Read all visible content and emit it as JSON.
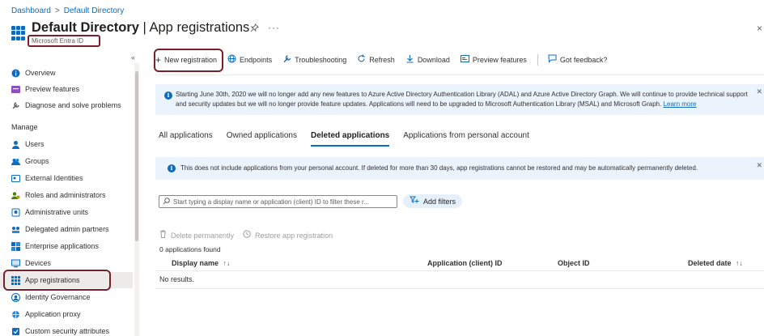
{
  "breadcrumb": {
    "items": [
      "Dashboard",
      "Default Directory"
    ]
  },
  "header": {
    "title_bold": "Default Directory",
    "title_rest": " | App registrations",
    "pin_icon": "pin-icon",
    "more": "···",
    "subtitle": "Microsoft Entra ID",
    "close": "×"
  },
  "sidebar": {
    "collapse": "«",
    "top_items": [
      {
        "label": "Overview",
        "icon": "info-icon"
      },
      {
        "label": "Preview features",
        "icon": "preview-icon"
      },
      {
        "label": "Diagnose and solve problems",
        "icon": "wrench-icon"
      }
    ],
    "section": "Manage",
    "manage_items": [
      {
        "label": "Users",
        "icon": "user-icon"
      },
      {
        "label": "Groups",
        "icon": "group-icon"
      },
      {
        "label": "External Identities",
        "icon": "external-identities-icon"
      },
      {
        "label": "Roles and administrators",
        "icon": "roles-icon"
      },
      {
        "label": "Administrative units",
        "icon": "admin-units-icon"
      },
      {
        "label": "Delegated admin partners",
        "icon": "partners-icon"
      },
      {
        "label": "Enterprise applications",
        "icon": "enterprise-apps-icon"
      },
      {
        "label": "Devices",
        "icon": "devices-icon"
      },
      {
        "label": "App registrations",
        "icon": "app-registrations-icon",
        "active": true
      },
      {
        "label": "Identity Governance",
        "icon": "governance-icon"
      },
      {
        "label": "Application proxy",
        "icon": "proxy-icon"
      },
      {
        "label": "Custom security attributes",
        "icon": "attributes-icon"
      }
    ]
  },
  "toolbar": {
    "new_registration": "New registration",
    "endpoints": "Endpoints",
    "troubleshooting": "Troubleshooting",
    "refresh": "Refresh",
    "download": "Download",
    "preview_features": "Preview features",
    "feedback": "Got feedback?"
  },
  "banner1": {
    "text": "Starting June 30th, 2020 we will no longer add any new features to Azure Active Directory Authentication Library (ADAL) and Azure Active Directory Graph. We will continue to provide technical support and security updates but we will no longer provide feature updates. Applications will need to be upgraded to Microsoft Authentication Library (MSAL) and Microsoft Graph.",
    "link": "Learn more"
  },
  "tabs": [
    {
      "label": "All applications"
    },
    {
      "label": "Owned applications"
    },
    {
      "label": "Deleted applications",
      "active": true
    },
    {
      "label": "Applications from personal account"
    }
  ],
  "banner2": {
    "text": "This does not include applications from your personal account. If deleted for more than 30 days, app registrations cannot be restored and may be automatically permanently deleted."
  },
  "search": {
    "placeholder": "Start typing a display name or application (client) ID to filter these r..."
  },
  "add_filters": "Add filters",
  "actions": {
    "delete": "Delete permanently",
    "restore": "Restore app registration"
  },
  "results_count": "0 applications found",
  "table": {
    "columns": [
      "Display name",
      "Application (client) ID",
      "Object ID",
      "Deleted date"
    ],
    "sort_icon": "↑↓",
    "empty": "No results."
  },
  "colors": {
    "accent": "#0f6cbd",
    "banner": "#ebf3fc",
    "annotation": "#7b1f2a"
  }
}
